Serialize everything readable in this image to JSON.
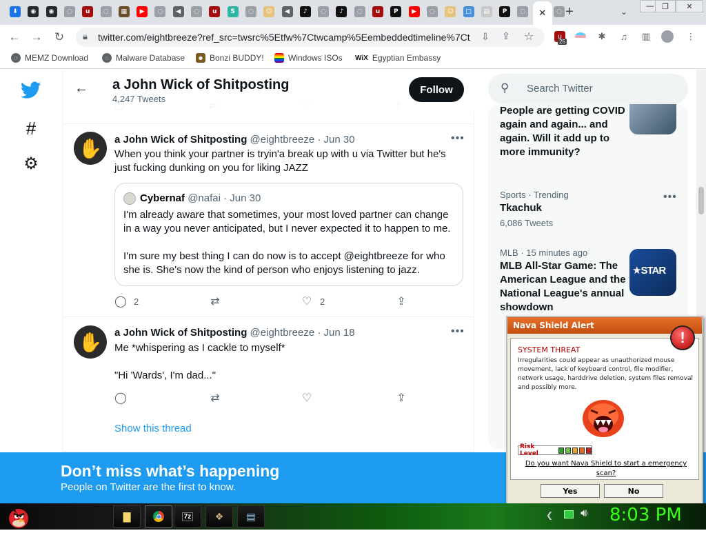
{
  "browser": {
    "tabs": [
      {
        "icon": "download-icon",
        "color": "#1a73e8",
        "glyph": "⬇"
      },
      {
        "icon": "github-icon",
        "color": "#24292f",
        "glyph": "◉"
      },
      {
        "icon": "github-icon",
        "color": "#24292f",
        "glyph": "◉"
      },
      {
        "icon": "globe-icon",
        "color": "#9aa0a6",
        "glyph": "◌"
      },
      {
        "icon": "ublock-icon",
        "color": "#a50d0d",
        "glyph": "u"
      },
      {
        "icon": "globe-icon",
        "color": "#9aa0a6",
        "glyph": "◌"
      },
      {
        "icon": "image-icon",
        "color": "#6b4f2a",
        "glyph": "▦"
      },
      {
        "icon": "youtube-icon",
        "color": "#ff0000",
        "glyph": "▶"
      },
      {
        "icon": "globe-icon",
        "color": "#9aa0a6",
        "glyph": "◌"
      },
      {
        "icon": "speaker-icon",
        "color": "#5f6368",
        "glyph": "◀"
      },
      {
        "icon": "globe-icon",
        "color": "#9aa0a6",
        "glyph": "◌"
      },
      {
        "icon": "ublock-icon",
        "color": "#a50d0d",
        "glyph": "u"
      },
      {
        "icon": "site-s-icon",
        "color": "#2fb5a3",
        "glyph": "S"
      },
      {
        "icon": "globe-icon",
        "color": "#9aa0a6",
        "glyph": "◌"
      },
      {
        "icon": "avatar-icon",
        "color": "#e7c27a",
        "glyph": "☺"
      },
      {
        "icon": "speaker-icon",
        "color": "#5f6368",
        "glyph": "◀"
      },
      {
        "icon": "tiktok-icon",
        "color": "#111111",
        "glyph": "♪"
      },
      {
        "icon": "globe-icon",
        "color": "#9aa0a6",
        "glyph": "◌"
      },
      {
        "icon": "tiktok-icon",
        "color": "#111111",
        "glyph": "♪"
      },
      {
        "icon": "globe-icon",
        "color": "#9aa0a6",
        "glyph": "◌"
      },
      {
        "icon": "ublock-icon",
        "color": "#a50d0d",
        "glyph": "u"
      },
      {
        "icon": "pbn-icon",
        "color": "#111111",
        "glyph": "P"
      },
      {
        "icon": "youtube-icon",
        "color": "#ff0000",
        "glyph": "▶"
      },
      {
        "icon": "globe-icon",
        "color": "#9aa0a6",
        "glyph": "◌"
      },
      {
        "icon": "avatar-icon",
        "color": "#e7c27a",
        "glyph": "☺"
      },
      {
        "icon": "square-icon",
        "color": "#4a90d9",
        "glyph": "□"
      },
      {
        "icon": "page-icon",
        "color": "#c8c8c8",
        "glyph": "▤"
      },
      {
        "icon": "pbn-icon",
        "color": "#111111",
        "glyph": "P"
      },
      {
        "icon": "globe-icon",
        "color": "#9aa0a6",
        "glyph": "◌"
      },
      {
        "icon": "close-icon",
        "color": "#202124",
        "glyph": "✕",
        "active": true
      },
      {
        "icon": "globe-icon",
        "color": "#9aa0a6",
        "glyph": "◌"
      }
    ],
    "new_tab": "+",
    "url": "twitter.com/eightbreeze?ref_src=twsrc%5Etfw%7Ctwcamp%5Eembeddedtimeline%7Ct...",
    "ext_badge": "25",
    "bookmarks": [
      {
        "label": "MEMZ Download",
        "color": "#5f6368"
      },
      {
        "label": "Malware Database",
        "color": "#5f6368"
      },
      {
        "label": "Bonzi BUDDY!",
        "color": "#7b5b1e"
      },
      {
        "label": "Windows ISOs",
        "color": "#e03a3a"
      },
      {
        "label": "Egyptian Embassy",
        "color": "#111111"
      }
    ]
  },
  "twitter": {
    "profile": {
      "name": "a John Wick of Shitposting",
      "tweet_count": "4,247 Tweets",
      "follow_label": "Follow"
    },
    "tweets": [
      {
        "name": "a John Wick of Shitposting",
        "handle": "@eightbreeze",
        "date": "· Jun 30",
        "text": "When you think your partner is tryin'a break up with u via Twitter but he's just fucking dunking on you for liking JAZZ",
        "quote": {
          "name": "Cybernaf",
          "handle": "@nafai",
          "date": "· Jun 30",
          "paragraph1": "I'm already aware that sometimes, your most loved partner can change in a way you never anticipated, but I never expected it to happen to me.",
          "paragraph2": "I'm sure my best thing I can do now is to accept @eightbreeze for who she is. She's now the kind of person who enjoys listening to jazz."
        },
        "replies": "2",
        "likes": "2"
      },
      {
        "name": "a John Wick of Shitposting",
        "handle": "@eightbreeze",
        "date": "· Jun 18",
        "line1": "Me *whispering as I cackle to myself*",
        "line2": "\"Hi 'Wards', I'm dad...\"",
        "show_thread": "Show this thread"
      }
    ],
    "search_placeholder": "Search Twitter",
    "trends": [
      {
        "title": "People are getting COVID again and again... and again. Will it add up to more immunity?"
      },
      {
        "meta": "Sports · Trending",
        "title": "Tkachuk",
        "count": "6,086 Tweets"
      },
      {
        "meta": "MLB · 15 minutes ago",
        "title": "MLB All-Star Game: The American League and the National League's annual showdown"
      }
    ],
    "banner": {
      "title": "Don’t miss what’s happening",
      "subtitle": "People on Twitter are the first to know."
    }
  },
  "nava": {
    "title": "Nava Shield Alert",
    "heading": "SYSTEM THREAT",
    "description": "Irregularities could appear as unauthorized mouse movement, lack of keyboard control, file modifier, network usage, harddrive deletion, system files removal and possibly more.",
    "risk_label": "Risk Level",
    "risk_colors": [
      "#2e9e2e",
      "#6cc04a",
      "#e8a628",
      "#e86a1c",
      "#c81e1e"
    ],
    "question": "Do you want Nava Shield to start a emergency scan?",
    "yes": "Yes",
    "no": "No"
  },
  "taskbar": {
    "clock": "8:03 PM",
    "items": [
      "folder-icon",
      "chrome-icon",
      "7zip-icon",
      "app-icon",
      "notepad-icon"
    ]
  }
}
